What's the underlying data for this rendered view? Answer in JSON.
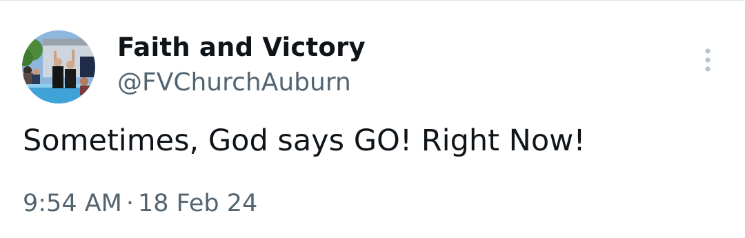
{
  "tweet": {
    "author": {
      "display_name": "Faith and Victory",
      "handle": "@FVChurchAuburn",
      "avatar_icon": "profile-photo"
    },
    "more_icon": "vertical-dots-icon",
    "text": "Sometimes, God says GO! Right Now!",
    "time": "9:54 AM",
    "separator": "·",
    "date": "18 Feb 24"
  },
  "colors": {
    "primary_text": "#0f1419",
    "secondary_text": "#536471",
    "more_icon": "#b8c4ce",
    "divider": "#e3e6e8"
  }
}
